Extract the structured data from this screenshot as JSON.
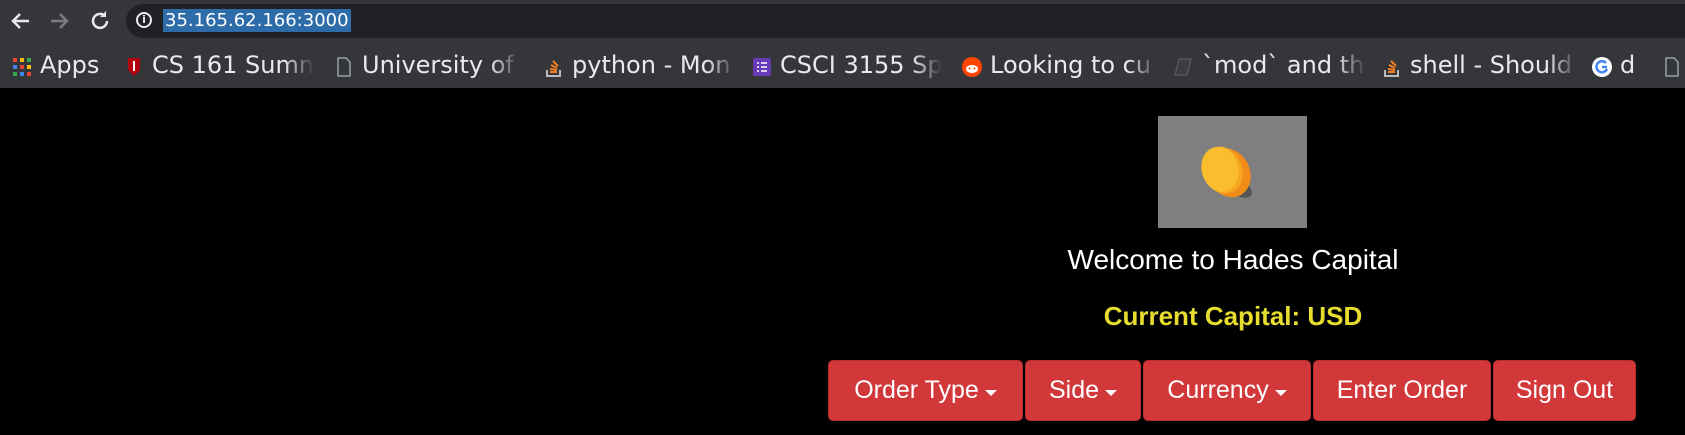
{
  "browser": {
    "back_icon": "arrow-left-icon",
    "forward_icon": "arrow-right-icon",
    "reload_icon": "reload-icon",
    "url": "35.165.62.166:3000"
  },
  "bookmarks": [
    {
      "label": "Apps",
      "icon": "apps-grid-icon"
    },
    {
      "label": "CS 161 Summ",
      "icon": "stanford-icon"
    },
    {
      "label": "University of",
      "icon": "document-icon"
    },
    {
      "label": "python - Mon",
      "icon": "stackoverflow-icon"
    },
    {
      "label": "CSCI 3155 Sp",
      "icon": "forms-icon"
    },
    {
      "label": "Looking to cu",
      "icon": "reddit-icon"
    },
    {
      "label": "`mod` and th",
      "icon": "bookmark-icon"
    },
    {
      "label": "shell - Should",
      "icon": "stackoverflow-icon"
    },
    {
      "label": "d",
      "icon": "google-icon"
    }
  ],
  "page": {
    "logo_icon": "gold-coin-icon",
    "welcome": "Welcome to Hades Capital",
    "capital": "Current Capital: USD",
    "buttons": {
      "order_type": "Order Type",
      "side": "Side",
      "currency": "Currency",
      "enter_order": "Enter Order",
      "sign_out": "Sign Out"
    }
  },
  "colors": {
    "button_red": "#d2383a",
    "capital_yellow": "#e6dd2e"
  }
}
